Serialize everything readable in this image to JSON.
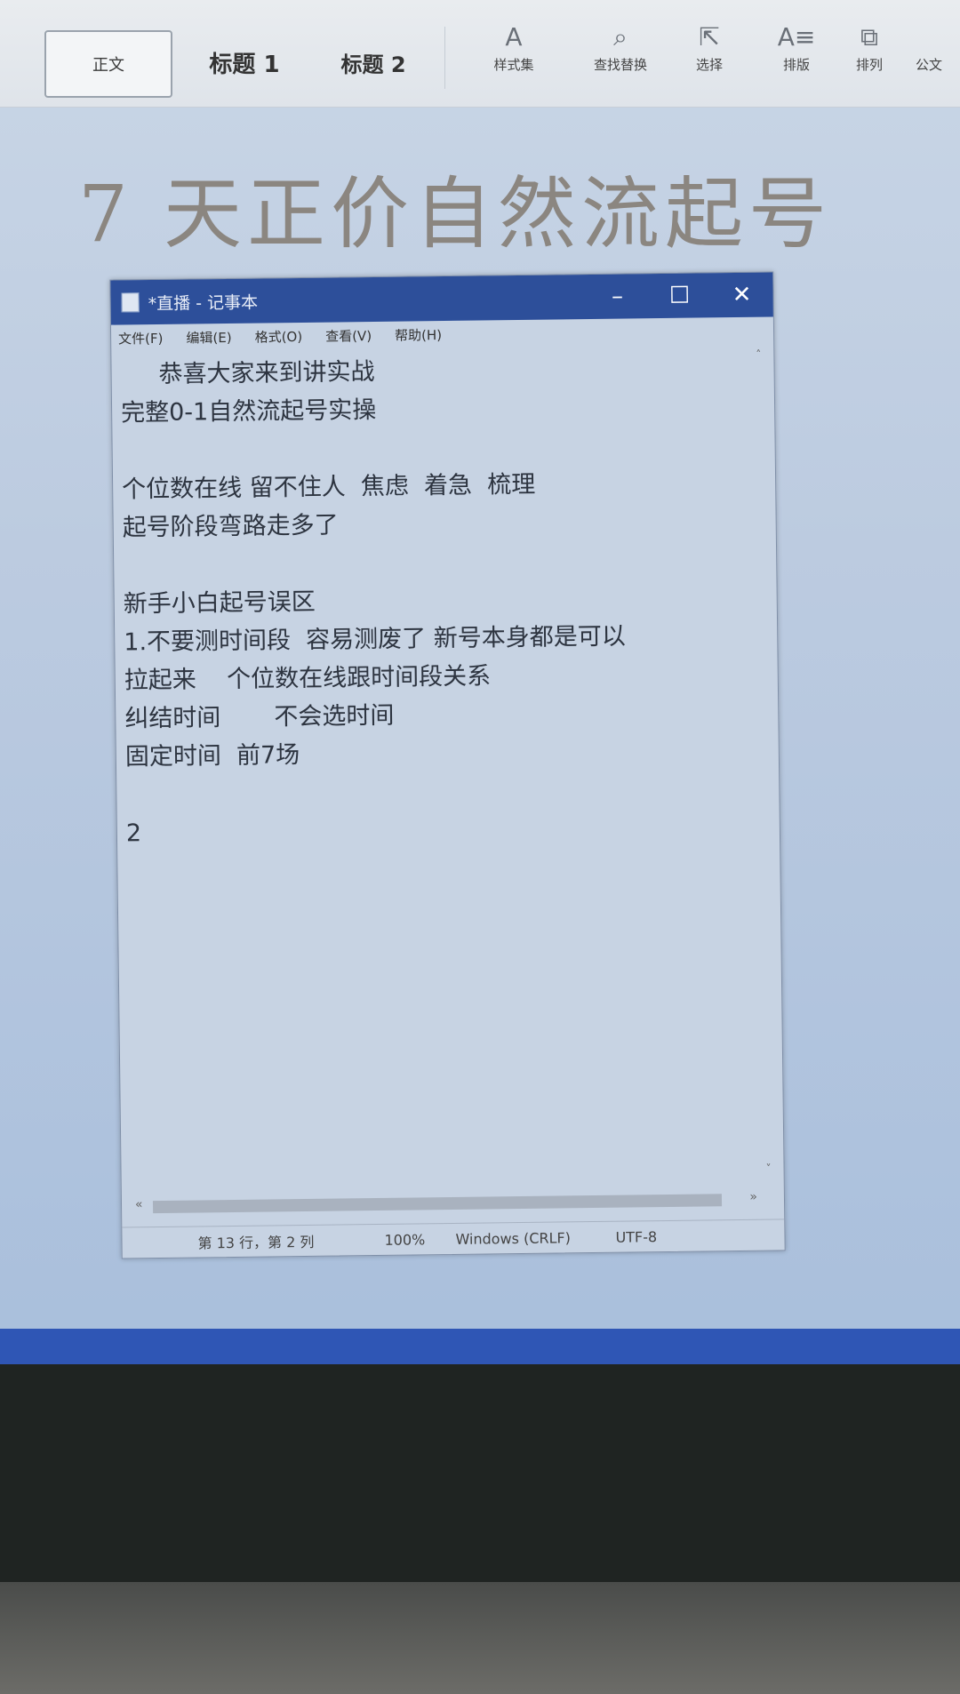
{
  "ribbon": {
    "style_normal": "正文",
    "style_heading1": "标题 1",
    "style_heading2": "标题 2",
    "tools": [
      {
        "label": "样式集",
        "icon": "style-set-icon",
        "glyph": "A"
      },
      {
        "label": "查找替换",
        "icon": "search-icon",
        "glyph": "⌕"
      },
      {
        "label": "选择",
        "icon": "cursor-select-icon",
        "glyph": "⇱"
      },
      {
        "label": "排版",
        "icon": "layout-icon",
        "glyph": "A≡"
      },
      {
        "label": "排列",
        "icon": "arrange-icon",
        "glyph": "⧉"
      },
      {
        "label": "公文",
        "icon": "",
        "glyph": ""
      }
    ]
  },
  "document": {
    "title": "7 天正价自然流起号"
  },
  "notepad": {
    "window_title": "*直播 - 记事本",
    "menu": [
      "文件(F)",
      "编辑(E)",
      "格式(O)",
      "查看(V)",
      "帮助(H)"
    ],
    "lines": [
      "     恭喜大家来到讲实战",
      "完整0-1自然流起号实操",
      "",
      "个位数在线 留不住人  焦虑  着急  梳理",
      "起号阶段弯路走多了",
      "",
      "新手小白起号误区",
      "1.不要测时间段  容易测废了 新号本身都是可以",
      "拉起来    个位数在线跟时间段关系",
      "纠结时间       不会选时间",
      "固定时间  前7场",
      "",
      "2"
    ],
    "status": {
      "position": "第 13 行，第 2 列",
      "zoom": "100%",
      "line_ending": "Windows (CRLF)",
      "encoding": "UTF-8"
    }
  }
}
